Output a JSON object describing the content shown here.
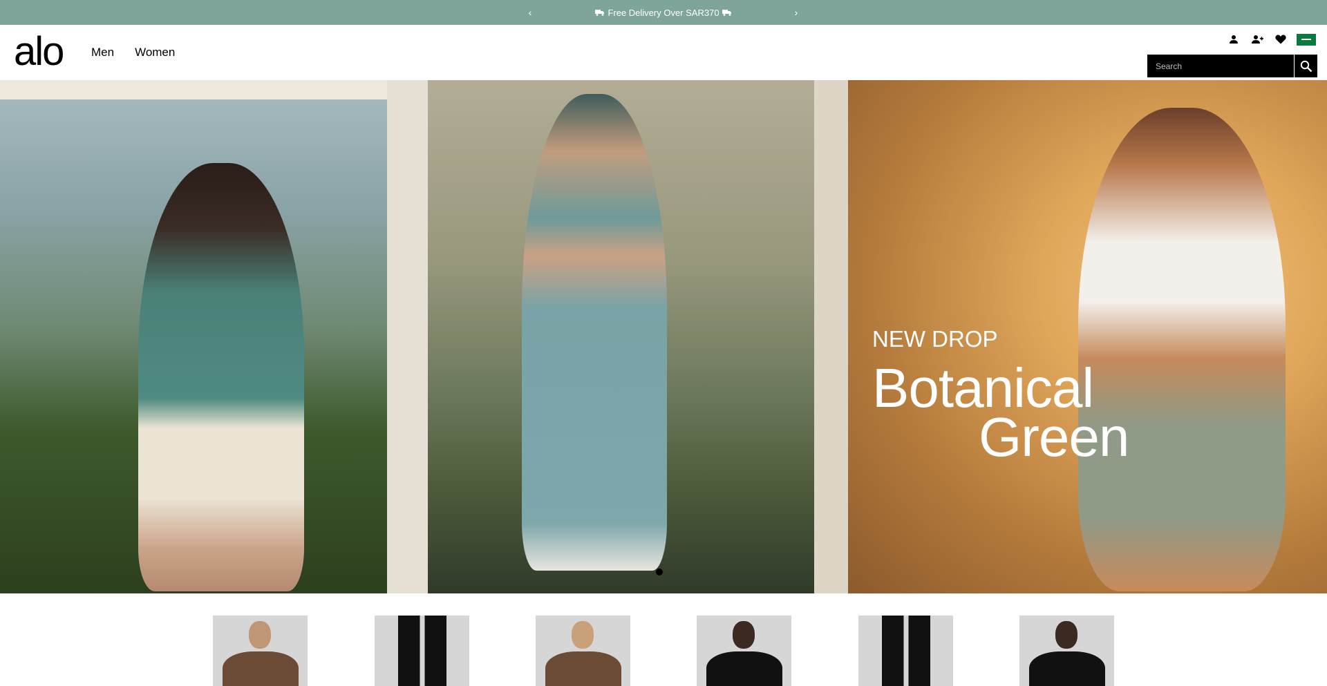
{
  "announcement": {
    "prev_label": "‹",
    "next_label": "›",
    "message": "Free Delivery Over SAR370",
    "background": "#7fa59b"
  },
  "header": {
    "logo": "alo",
    "nav": [
      "Men",
      "Women"
    ],
    "icons": [
      "account-icon",
      "add-user-icon",
      "wishlist-heart-icon",
      "saudi-flag-icon"
    ],
    "search": {
      "placeholder": "Search"
    }
  },
  "hero": {
    "kicker": "NEW DROP",
    "title_line1": "Botanical",
    "title_line2": "Green",
    "active_slide": 1
  },
  "products": [
    {
      "name": "brown-sweatshirt",
      "color": "#6b4a36"
    },
    {
      "name": "black-sweatpants",
      "color": "#111111"
    },
    {
      "name": "brown-hoodie",
      "color": "#6b4a36"
    },
    {
      "name": "black-top",
      "color": "#111111"
    },
    {
      "name": "black-joggers",
      "color": "#111111"
    },
    {
      "name": "black-wrap-top",
      "color": "#111111"
    }
  ]
}
